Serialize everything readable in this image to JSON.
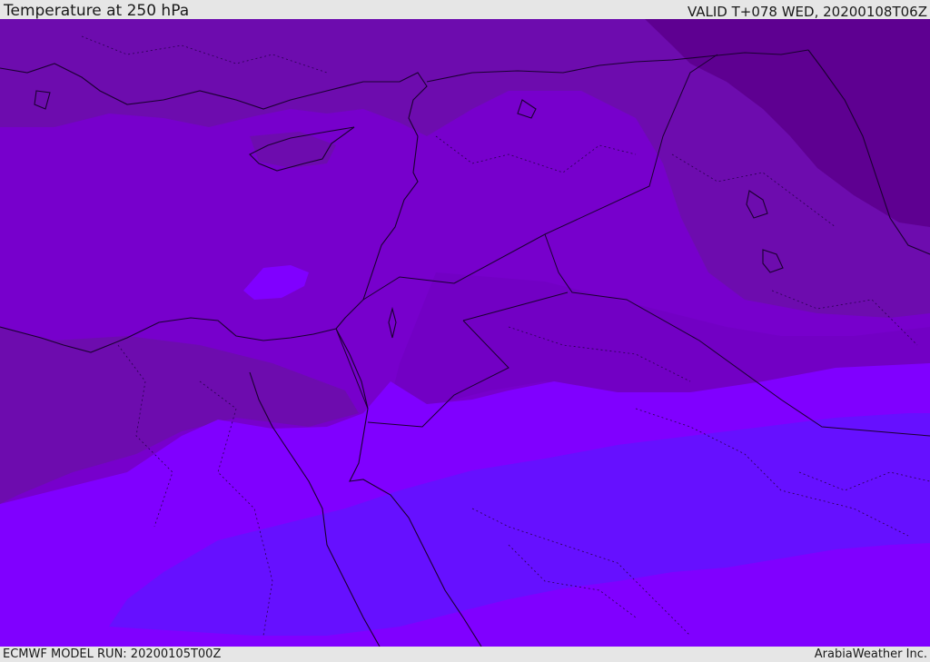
{
  "header": {
    "title": "Temperature at 250 hPa",
    "valid_time": "VALID T+078 WED, 20200108T06Z"
  },
  "footer": {
    "model_run": "ECMWF MODEL RUN: 20200105T00Z",
    "credit": "ArabiaWeather Inc."
  },
  "map": {
    "region": "Eastern Mediterranean / Middle East",
    "colors": {
      "coldest": "#5e0091",
      "colder": "#6d0cae",
      "cold": "#7700cc",
      "mild": "#7a00e6",
      "warm": "#8000ff",
      "warmest": "#6610ff"
    }
  }
}
